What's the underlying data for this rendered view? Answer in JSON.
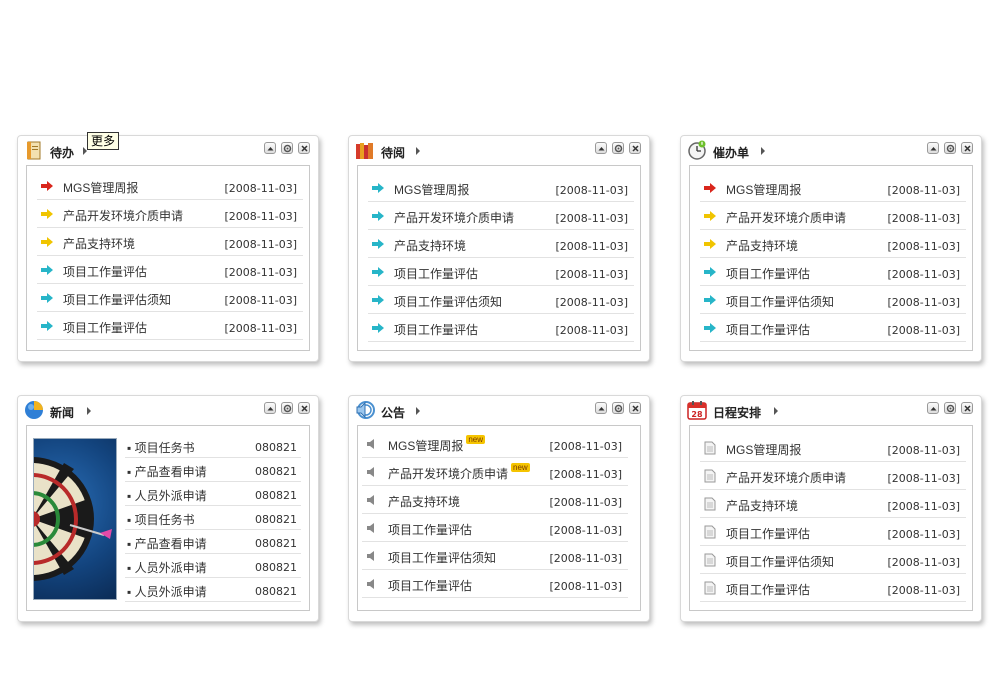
{
  "tooltip": "更多",
  "panels": {
    "todo": {
      "title": "待办"
    },
    "read": {
      "title": "待阅"
    },
    "urge": {
      "title": "催办单"
    },
    "news": {
      "title": "新闻"
    },
    "notice": {
      "title": "公告"
    },
    "sched": {
      "title": "日程安排"
    }
  },
  "todo_items": [
    {
      "text": "MGS管理周报",
      "date": "[2008-11-03]",
      "icon": "red-arrow-icon"
    },
    {
      "text": "产品开发环境介质申请",
      "date": "[2008-11-03]",
      "icon": "yellow-arrow-icon"
    },
    {
      "text": "产品支持环境",
      "date": "[2008-11-03]",
      "icon": "yellow-arrow-icon"
    },
    {
      "text": "项目工作量评估",
      "date": "[2008-11-03]",
      "icon": "teal-arrow-icon"
    },
    {
      "text": "项目工作量评估须知",
      "date": "[2008-11-03]",
      "icon": "teal-arrow-icon"
    },
    {
      "text": "项目工作量评估",
      "date": "[2008-11-03]",
      "icon": "teal-arrow-icon"
    }
  ],
  "read_items": [
    {
      "text": "MGS管理周报",
      "date": "[2008-11-03]"
    },
    {
      "text": "产品开发环境介质申请",
      "date": "[2008-11-03]"
    },
    {
      "text": "产品支持环境",
      "date": "[2008-11-03]"
    },
    {
      "text": "项目工作量评估",
      "date": "[2008-11-03]"
    },
    {
      "text": "项目工作量评估须知",
      "date": "[2008-11-03]"
    },
    {
      "text": "项目工作量评估",
      "date": "[2008-11-03]"
    }
  ],
  "urge_items": [
    {
      "text": "MGS管理周报",
      "date": "[2008-11-03]"
    },
    {
      "text": "产品开发环境介质申请",
      "date": "[2008-11-03]"
    },
    {
      "text": "产品支持环境",
      "date": "[2008-11-03]"
    },
    {
      "text": "项目工作量评估",
      "date": "[2008-11-03]"
    },
    {
      "text": "项目工作量评估须知",
      "date": "[2008-11-03]"
    },
    {
      "text": "项目工作量评估",
      "date": "[2008-11-03]"
    }
  ],
  "news_items": [
    {
      "text": "▪ 项目任务书",
      "date": "080821"
    },
    {
      "text": "▪ 产品查看申请",
      "date": "080821"
    },
    {
      "text": "▪ 人员外派申请",
      "date": "080821"
    },
    {
      "text": "▪ 项目任务书",
      "date": "080821"
    },
    {
      "text": "▪ 产品查看申请",
      "date": "080821"
    },
    {
      "text": "▪ 人员外派申请",
      "date": "080821"
    },
    {
      "text": "▪ 人员外派申请",
      "date": "080821"
    }
  ],
  "notice_items": [
    {
      "text": "MGS管理周报",
      "date": "[2008-11-03]",
      "badge": "new"
    },
    {
      "text": "产品开发环境介质申请",
      "date": "[2008-11-03]",
      "badge": "new"
    },
    {
      "text": "产品支持环境",
      "date": "[2008-11-03]"
    },
    {
      "text": "项目工作量评估",
      "date": "[2008-11-03]"
    },
    {
      "text": "项目工作量评估须知",
      "date": "[2008-11-03]"
    },
    {
      "text": "项目工作量评估",
      "date": "[2008-11-03]"
    }
  ],
  "sched_items": [
    {
      "text": "MGS管理周报",
      "date": "[2008-11-03]"
    },
    {
      "text": "产品开发环境介质申请",
      "date": "[2008-11-03]"
    },
    {
      "text": "产品支持环境",
      "date": "[2008-11-03]"
    },
    {
      "text": "项目工作量评估",
      "date": "[2008-11-03]"
    },
    {
      "text": "项目工作量评估须知",
      "date": "[2008-11-03]"
    },
    {
      "text": "项目工作量评估",
      "date": "[2008-11-03]"
    }
  ],
  "calendar_icon_day": "28",
  "colors": {
    "red_arrow": "#d9261c",
    "yellow_arrow": "#f0c400",
    "teal_arrow": "#27b5c8"
  }
}
